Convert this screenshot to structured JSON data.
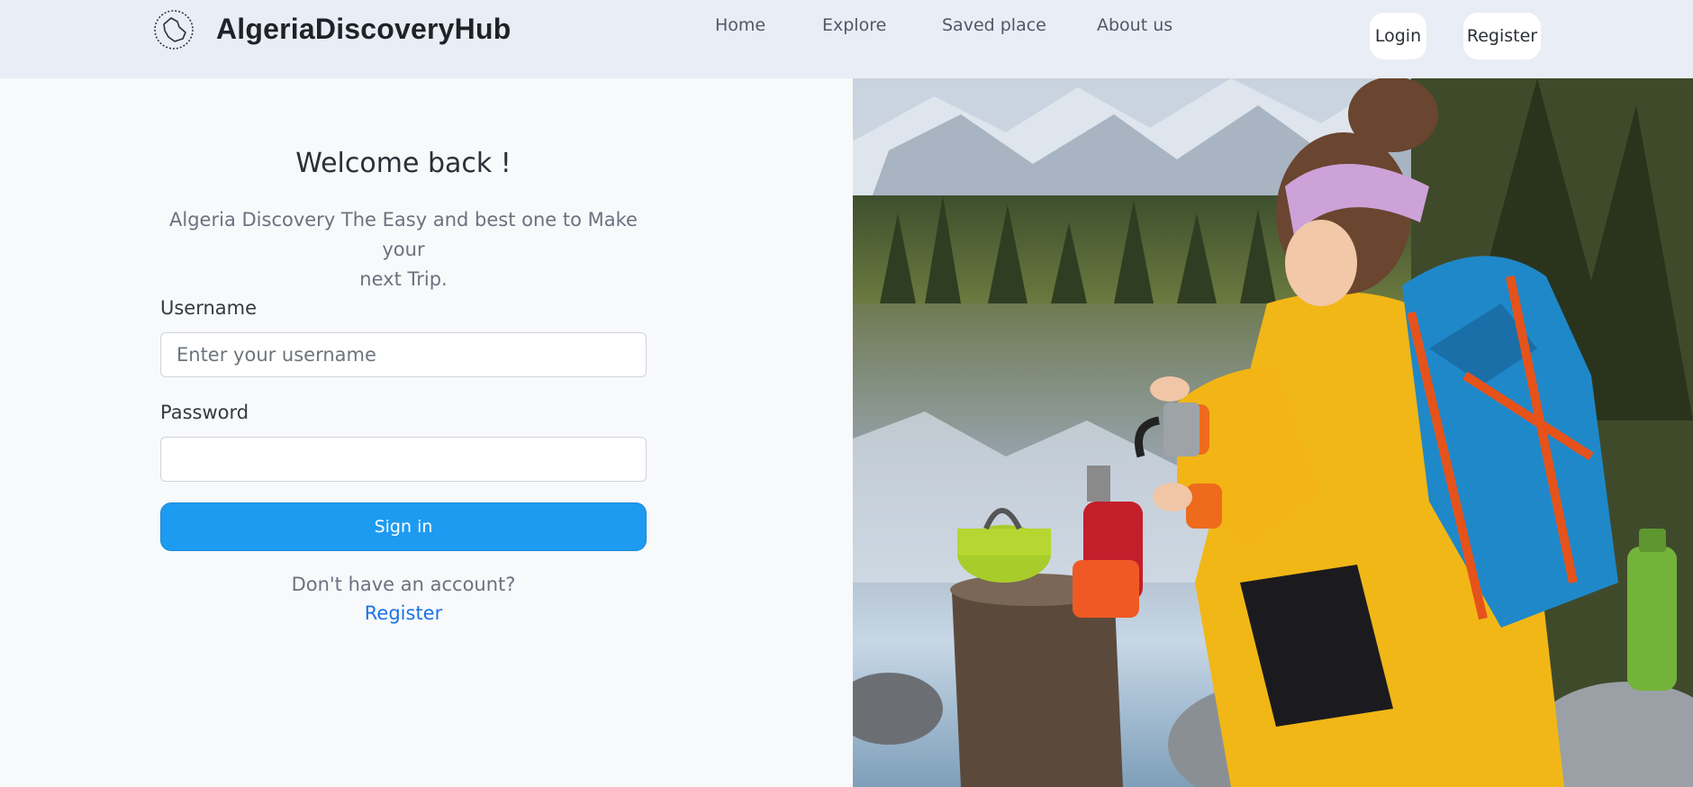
{
  "header": {
    "brand": "AlgeriaDiscoveryHub",
    "logo_icon": "algeria-map-icon",
    "nav": [
      "Home",
      "Explore",
      "Saved place",
      "About us"
    ],
    "login_label": "Login",
    "register_label": "Register"
  },
  "form": {
    "title": "Welcome back !",
    "subtitle_line1": "Algeria Discovery The Easy and best one to Make your",
    "subtitle_line2": "next Trip.",
    "username_label": "Username",
    "username_placeholder": "Enter your username",
    "password_label": "Password",
    "password_placeholder": "",
    "signin_label": "Sign in",
    "no_account_text": "Don't have an account?",
    "register_link": "Register"
  },
  "colors": {
    "header_bg": "#e9edf5",
    "page_bg": "#f8f9fb",
    "accent": "#1d9bf0",
    "link": "#1a73e8"
  }
}
